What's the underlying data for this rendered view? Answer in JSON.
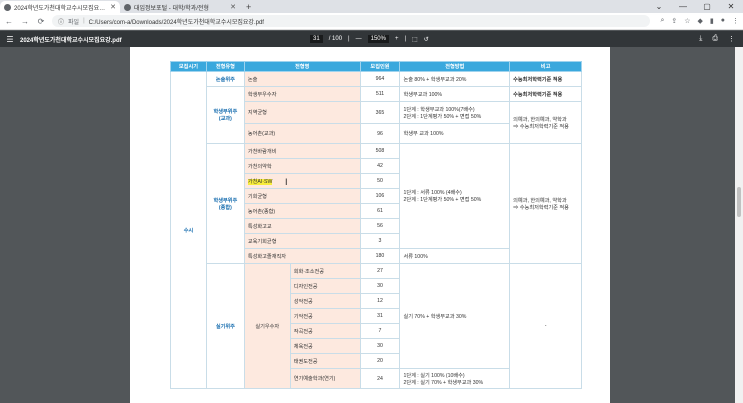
{
  "browser": {
    "tabs": [
      {
        "label": "2024학년도가천대학교수시모집요강.pdf",
        "active": true
      },
      {
        "label": "대입정보포털 - 대학/학과/전형",
        "active": false
      }
    ],
    "address_prefix": "파일",
    "address": "C:/Users/com-a/Downloads/2024학년도가천대학교수시모집요강.pdf"
  },
  "pdf_toolbar": {
    "filename": "2024학년도가천대학교수시모집요강.pdf",
    "page_current": "31",
    "page_total": "/ 100",
    "zoom": "150%"
  },
  "table": {
    "headers": [
      "모집시기",
      "전형유형",
      "전형명",
      "모집인원",
      "전형방법",
      "비고"
    ],
    "sihwan": "수시",
    "types": {
      "t1": "논술위주",
      "t2": "학생부위주\n(교과)",
      "t3": "학생부위주\n(종합)",
      "t4": "실기위주"
    },
    "rows": {
      "r1": {
        "name": "논술",
        "count": "964",
        "method": "논술 80% + 학생부교과 20%",
        "note": "수능최저학력기준 적용"
      },
      "r2": {
        "name": "학생부우수자",
        "count": "511",
        "method": "학생부교과 100%",
        "note": "수능최저학력기준 적용"
      },
      "r3": {
        "name": "지역균형",
        "count": "365",
        "method1": "1단계 : 학생부교과 100%(7배수)",
        "method2": "2단계 : 1단계평가 50% + 면접 50%"
      },
      "r4": {
        "name": "농어촌(교과)",
        "count": "96",
        "method": "학생부 교과 100%",
        "note1": "의예과, 한의예과, 약학과",
        "note2": "⇒ 수능최저학력기준 적용"
      },
      "r5": {
        "name": "가천바람개비",
        "count": "508"
      },
      "r6": {
        "name": "가천의약학",
        "count": "42"
      },
      "r7": {
        "name": "가천AI·SW",
        "count": "50"
      },
      "r8": {
        "name": "기회균형",
        "count": "106"
      },
      "r9": {
        "name": "농어촌(종합)",
        "count": "61"
      },
      "r10": {
        "name": "특성화고교",
        "count": "56"
      },
      "r11": {
        "name": "교육기회균형",
        "count": "3"
      },
      "r12": {
        "name": "특성화고졸재직자",
        "count": "180",
        "method": "서류 100%"
      },
      "jonghap_method1": "1단계 : 서류 100% (4배수)",
      "jonghap_method2": "2단계 : 1단계평가 50% + 면접 50%",
      "jonghap_note1": "의예과, 한의예과, 약학과",
      "jonghap_note2": "⇒ 수능최저학력기준 적용",
      "silgi_name": "실기우수자",
      "s1": {
        "dept": "회화·조소전공",
        "count": "27"
      },
      "s2": {
        "dept": "디자인전공",
        "count": "30"
      },
      "s3": {
        "dept": "성악전공",
        "count": "12"
      },
      "s4": {
        "dept": "기악전공",
        "count": "31"
      },
      "s5": {
        "dept": "작곡전공",
        "count": "7"
      },
      "s6": {
        "dept": "체육전공",
        "count": "30"
      },
      "s7": {
        "dept": "태권도전공",
        "count": "20"
      },
      "s8": {
        "dept": "연기예술학과(연기)",
        "count": "24",
        "method1": "1단계 : 실기 100% (10배수)",
        "method2": "2단계 : 실기 70% + 학생부교과 30%"
      },
      "silgi_method": "실기 70% + 학생부교과 30%",
      "silgi_note": "-"
    }
  }
}
